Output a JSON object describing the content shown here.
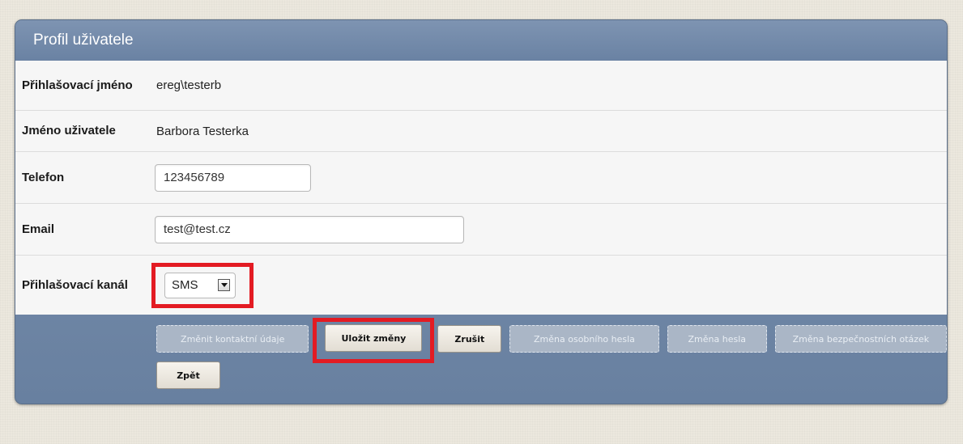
{
  "panel": {
    "title": "Profil uživatele"
  },
  "form": {
    "login_name": {
      "label": "Přihlašovací jméno",
      "value": "ereg\\testerb"
    },
    "user_name": {
      "label": "Jméno uživatele",
      "value": "Barbora Testerka"
    },
    "phone": {
      "label": "Telefon",
      "value": "123456789"
    },
    "email": {
      "label": "Email",
      "value": "test@test.cz"
    },
    "login_channel": {
      "label": "Přihlašovací kanál",
      "selected": "SMS"
    }
  },
  "buttons": {
    "change_contact": "Změnit kontaktní údaje",
    "save_changes": "Uložit změny",
    "cancel": "Zrušit",
    "change_personal_password": "Změna osobního hesla",
    "change_password": "Změna hesla",
    "change_security_questions": "Změna bezpečnostních otázek",
    "back": "Zpět"
  },
  "icons": {
    "dropdown": "chevron-down-icon"
  },
  "colors": {
    "header": "#7890ae",
    "highlight": "#e31b23",
    "background": "#ece8de"
  }
}
